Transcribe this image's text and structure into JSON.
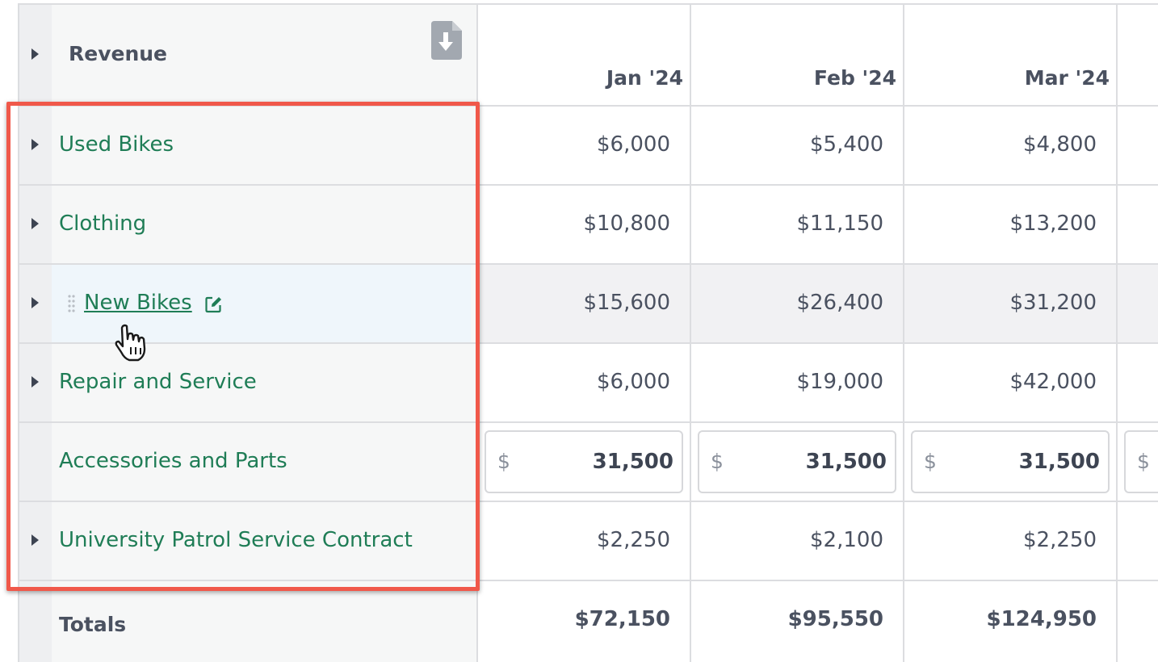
{
  "header": {
    "title": "Revenue",
    "months": [
      "Jan '24",
      "Feb '24",
      "Mar '24"
    ]
  },
  "rows": [
    {
      "label": "Used Bikes",
      "values": [
        "$6,000",
        "$5,400",
        "$4,800"
      ]
    },
    {
      "label": "Clothing",
      "values": [
        "$10,800",
        "$11,150",
        "$13,200"
      ]
    },
    {
      "label": "New Bikes",
      "values": [
        "$15,600",
        "$26,400",
        "$31,200"
      ]
    },
    {
      "label": "Repair and Service",
      "values": [
        "$6,000",
        "$19,000",
        "$42,000"
      ]
    },
    {
      "label": "Accessories and Parts",
      "currency": "$",
      "inputs": [
        "31,500",
        "31,500",
        "31,500"
      ]
    },
    {
      "label": "University Patrol Service Contract",
      "values": [
        "$2,250",
        "$2,100",
        "$2,250"
      ]
    }
  ],
  "totals": {
    "label": "Totals",
    "values": [
      "$72,150",
      "$95,550",
      "$124,950"
    ]
  },
  "colors": {
    "accent_green": "#1f7d56",
    "highlight_red": "#f0584a"
  },
  "icons": [
    "download-file-icon",
    "caret-right-icon",
    "drag-handle-icon",
    "edit-icon",
    "hand-pointer-cursor-icon"
  ]
}
